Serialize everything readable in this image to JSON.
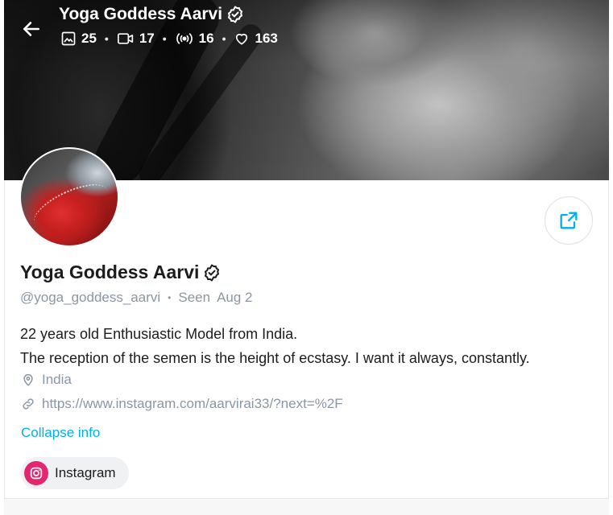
{
  "header": {
    "title": "Yoga Goddess Aarvi",
    "stats": [
      {
        "icon": "image-icon",
        "value": "25"
      },
      {
        "icon": "video-icon",
        "value": "17"
      },
      {
        "icon": "broadcast-icon",
        "value": "16"
      },
      {
        "icon": "heart-icon",
        "value": "163"
      }
    ]
  },
  "profile": {
    "name": "Yoga Goddess Aarvi",
    "handle": "@yoga_goddess_aarvi",
    "seen_label": "Seen",
    "seen_date": "Aug 2",
    "bio_line1": "22 years old Enthusiastic Model from India.",
    "bio_line2": "The reception of the semen is the height of ecstasy. I want it always, constantly.",
    "location": "India",
    "website": "https://www.instagram.com/aarvirai33/?next=%2F",
    "collapse_label": "Collapse info",
    "social_links": [
      {
        "label": "Instagram",
        "icon": "instagram-icon"
      }
    ]
  },
  "colors": {
    "accent": "#00aff0",
    "muted_text": "#8a96a3",
    "instagram": "#e4266f"
  }
}
